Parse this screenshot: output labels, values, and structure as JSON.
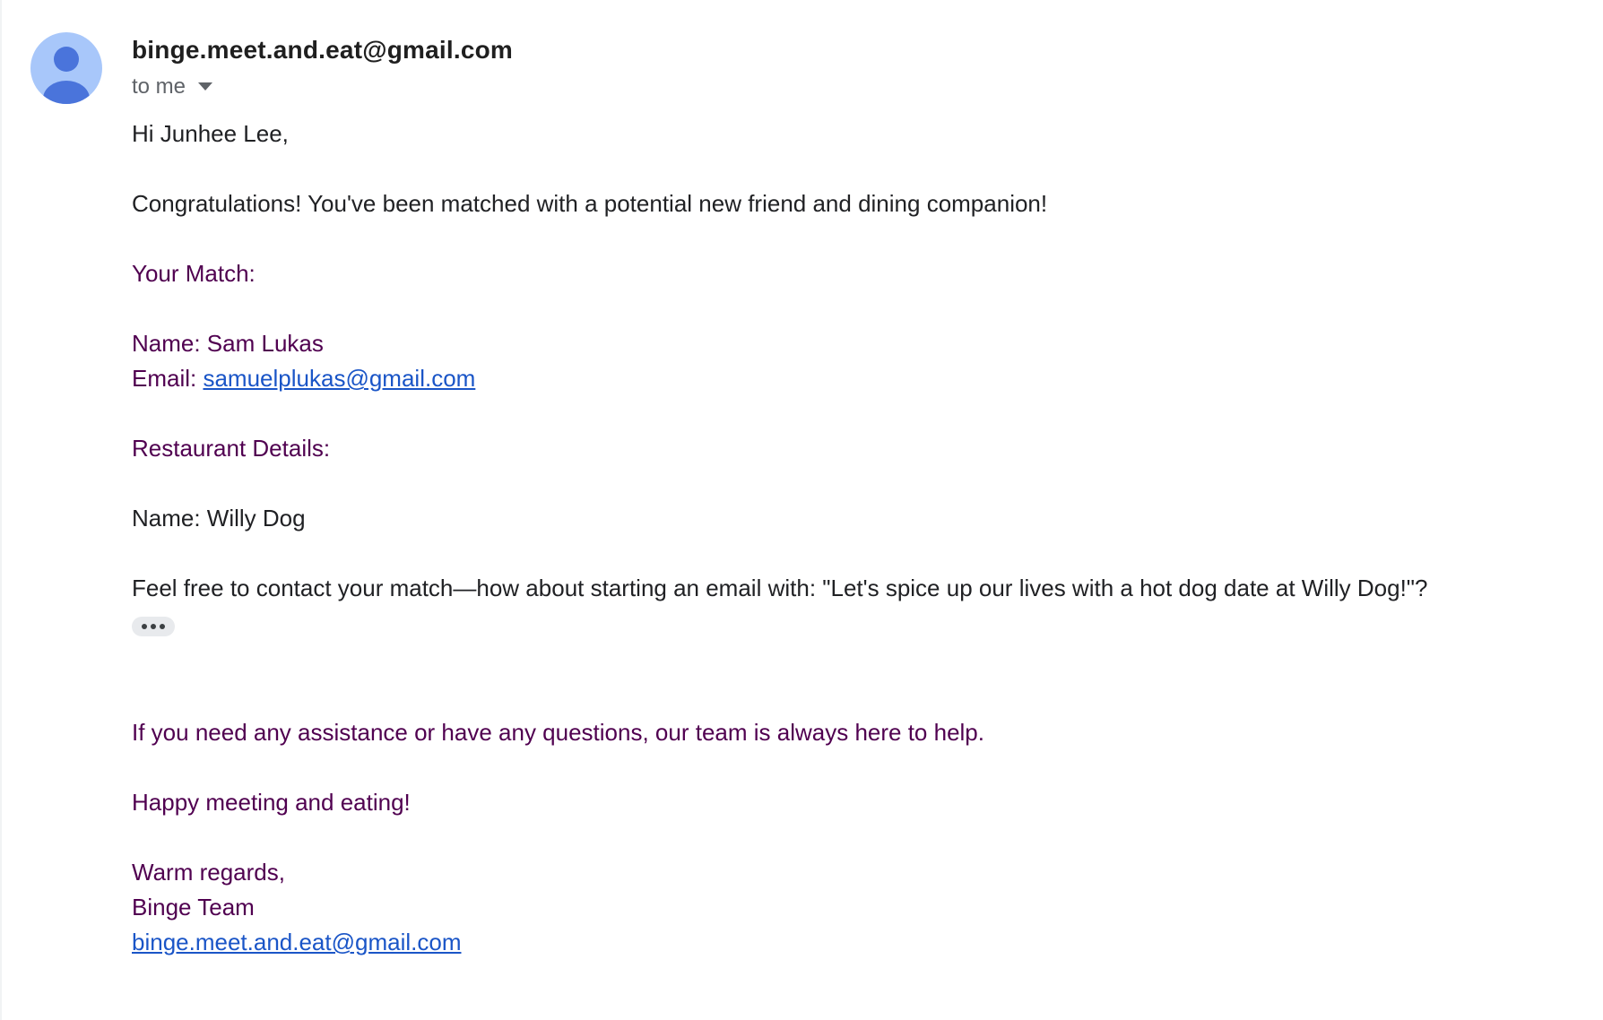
{
  "sender": {
    "email": "binge.meet.and.eat@gmail.com"
  },
  "recipient": {
    "label": "to me"
  },
  "body": {
    "greeting": "Hi Junhee Lee,",
    "congrats": "Congratulations! You've been matched with a potential new friend and dining companion!",
    "match_heading": "Your Match:",
    "match_name": "Name: Sam Lukas",
    "match_email_label": "Email: ",
    "match_email": "samuelplukas@gmail.com",
    "restaurant_heading": "Restaurant Details:",
    "restaurant_name": "Name: Willy Dog",
    "contact_suggestion": "Feel free to contact your match—how about starting an email with: \"Let's spice up our lives with a hot dog date at Willy Dog!\"?",
    "assistance": "If you need any assistance or have any questions, our team is always here to help.",
    "closing_line": "Happy meeting and eating!",
    "signoff": "Warm regards,",
    "team": "Binge Team",
    "team_email": "binge.meet.and.eat@gmail.com"
  },
  "icons": {
    "avatar": "person-avatar-icon",
    "recipient_dropdown": "caret-down-icon",
    "show_trimmed": "more-horizontal-icon"
  },
  "colors": {
    "avatar_bg": "#a8c7fa",
    "avatar_figure": "#4a74db",
    "quoted_text": "#500050",
    "link": "#1a55c7",
    "body_text": "#202124",
    "secondary_text": "#5f6368"
  }
}
